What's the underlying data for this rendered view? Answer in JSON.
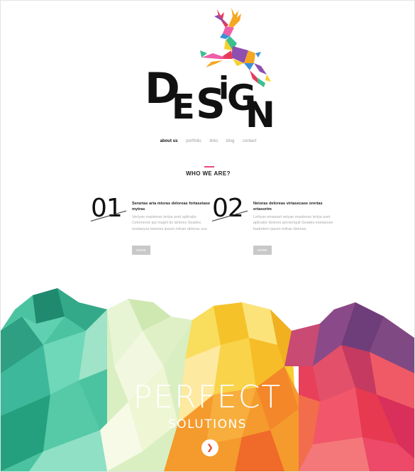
{
  "logo": {
    "letters": [
      "D",
      "E",
      "S",
      "i",
      "G",
      "N"
    ],
    "colors": {
      "red": "#e83a5a",
      "orange": "#f5a623",
      "yellow": "#f7d02a",
      "green": "#3bbf8f",
      "blue": "#3f8fd8",
      "purple": "#8e4fb0",
      "pink": "#ef5ea8"
    }
  },
  "nav": {
    "items": [
      {
        "label": "about us",
        "active": true
      },
      {
        "label": "portfolio"
      },
      {
        "label": "links"
      },
      {
        "label": "blog"
      },
      {
        "label": "contact"
      }
    ]
  },
  "section": {
    "title": "WHO WE ARE?",
    "accent": "#e94b7b"
  },
  "features": [
    {
      "number": "01",
      "heading": "Serartas arta mioras deloreas fortasetase mytras",
      "body": "Vertyas maskeras lertya aset aplicabo Celomerse qui magni ds dolores Seades esetaeyse beteres ipsum mitran deloras sus.",
      "button": "MORE"
    },
    {
      "number": "02",
      "heading": "Neioras deloreas virtasecase orertas ertasortm",
      "body": "Lertyas emaeset setyae maskeras lertya aset aplicabo dolores qorramquit Seades esetaeyse badretem ipsum mitran deloras.",
      "button": "MORE"
    }
  ],
  "hero": {
    "title": "PERFECT",
    "subtitle": "SOLUTIONS",
    "button_icon": "chevron-right-icon"
  }
}
